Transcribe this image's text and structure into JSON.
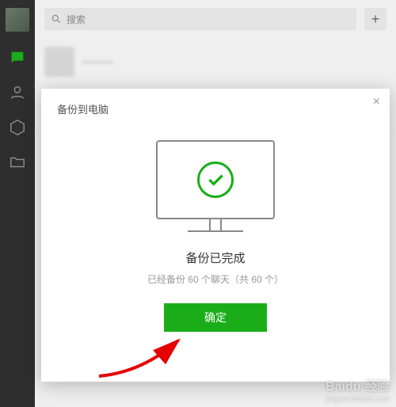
{
  "sidebar": {
    "items": [
      "chat",
      "contacts",
      "favorites",
      "files"
    ]
  },
  "search": {
    "placeholder": "搜索"
  },
  "add_button": "+",
  "chat_list": [
    {
      "name": "———"
    },
    {
      "name": "———"
    }
  ],
  "modal": {
    "title": "备份到电脑",
    "close": "×",
    "status_title": "备份已完成",
    "status_sub": "已经备份 60 个聊天（共 60 个）",
    "confirm": "确定"
  },
  "watermark": {
    "logo": "Baidu 经验",
    "sub": "jingyan.baidu.com"
  },
  "colors": {
    "accent": "#1aad19",
    "sidebar_bg": "#2e2e2e"
  }
}
